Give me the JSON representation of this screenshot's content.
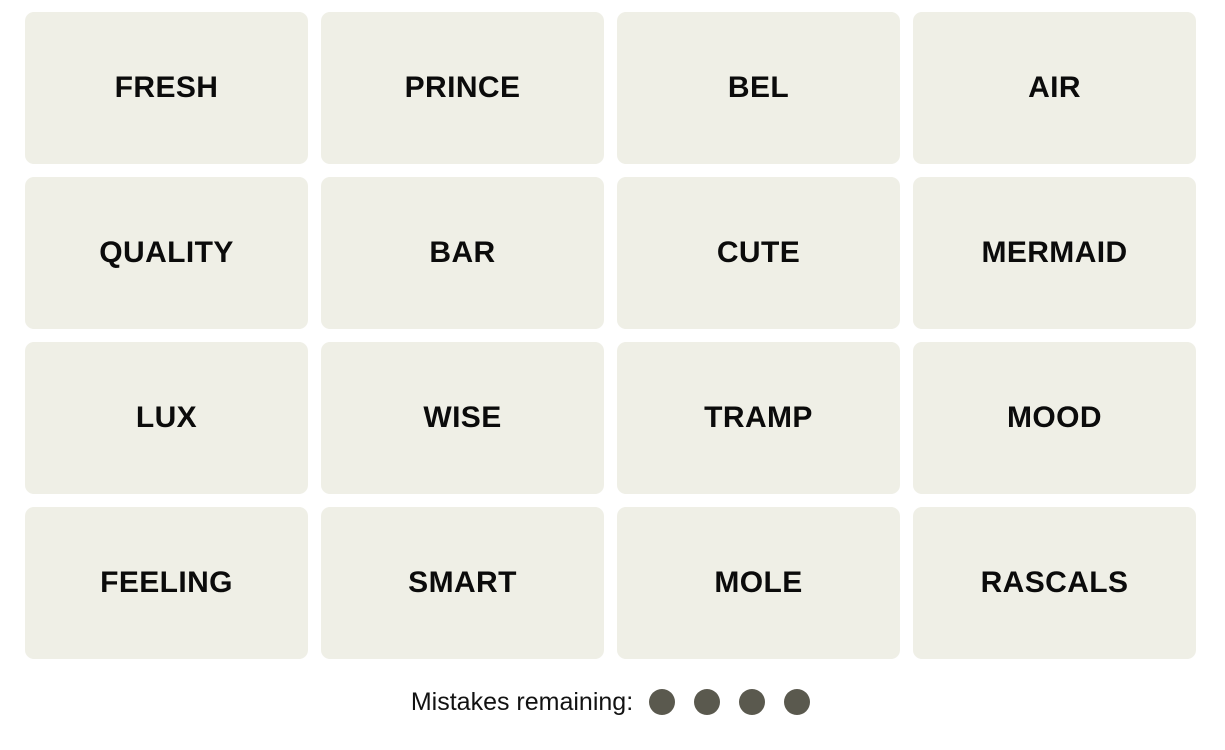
{
  "board": {
    "columns": 4,
    "rows": 4,
    "tile_color": "#EFEFE6",
    "tile_text_color": "#0b0b0b",
    "background_color": "#FFFFFF",
    "tiles": [
      {
        "label": "FRESH",
        "row": 1,
        "col": 1,
        "selected": false
      },
      {
        "label": "PRINCE",
        "row": 1,
        "col": 2,
        "selected": false
      },
      {
        "label": "BEL",
        "row": 1,
        "col": 3,
        "selected": false
      },
      {
        "label": "AIR",
        "row": 1,
        "col": 4,
        "selected": false
      },
      {
        "label": "QUALITY",
        "row": 2,
        "col": 1,
        "selected": false
      },
      {
        "label": "BAR",
        "row": 2,
        "col": 2,
        "selected": false
      },
      {
        "label": "CUTE",
        "row": 2,
        "col": 3,
        "selected": false
      },
      {
        "label": "MERMAID",
        "row": 2,
        "col": 4,
        "selected": false
      },
      {
        "label": "LUX",
        "row": 3,
        "col": 1,
        "selected": false
      },
      {
        "label": "WISE",
        "row": 3,
        "col": 2,
        "selected": false
      },
      {
        "label": "TRAMP",
        "row": 3,
        "col": 3,
        "selected": false
      },
      {
        "label": "MOOD",
        "row": 3,
        "col": 4,
        "selected": false
      },
      {
        "label": "FEELING",
        "row": 4,
        "col": 1,
        "selected": false
      },
      {
        "label": "SMART",
        "row": 4,
        "col": 2,
        "selected": false
      },
      {
        "label": "MOLE",
        "row": 4,
        "col": 3,
        "selected": false
      },
      {
        "label": "RASCALS",
        "row": 4,
        "col": 4,
        "selected": false
      }
    ]
  },
  "mistakes": {
    "label": "Mistakes remaining:",
    "remaining": 4,
    "dot_color": "#5A594E",
    "dots": [
      "dot-1",
      "dot-2",
      "dot-3",
      "dot-4"
    ]
  }
}
